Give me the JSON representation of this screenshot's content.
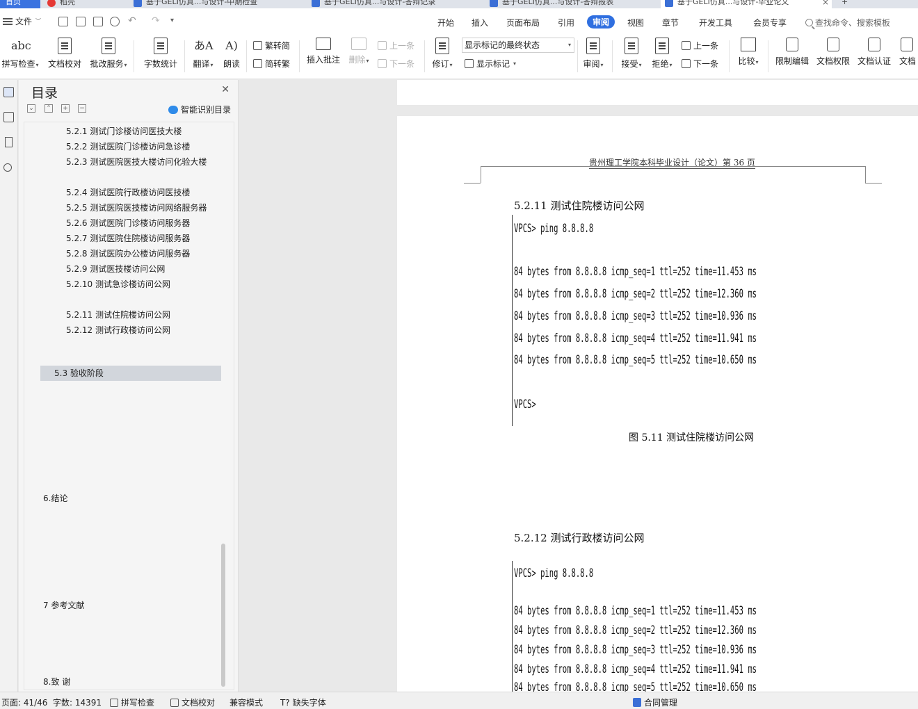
{
  "tabs": [
    {
      "label": "首页",
      "type": "home"
    },
    {
      "label": "稻壳",
      "type": "normal"
    },
    {
      "label": "基于GELI仿真...与设计-中期检查",
      "type": "normal"
    },
    {
      "label": "基于GELI仿真...与设计-答辩记录",
      "type": "normal"
    },
    {
      "label": "基于GELI仿真...与设计-答辩报表",
      "type": "normal"
    },
    {
      "label": "基于GELI仿真...与设计-毕业论文",
      "type": "active"
    }
  ],
  "menubar": {
    "file": "文件",
    "tabs": [
      "开始",
      "插入",
      "页面布局",
      "引用",
      "审阅",
      "视图",
      "章节",
      "开发工具",
      "会员专享"
    ],
    "active_tab": "审阅",
    "search_placeholder": "查找命令、搜索模板"
  },
  "ribbon": {
    "spell_check": "拼写检查",
    "doc_proof": "文档校对",
    "annotate_service": "批改服务",
    "word_count": "字数统计",
    "translate": "翻译",
    "read_aloud": "朗读",
    "trad_to_simp": "繁转简",
    "simp_to_trad": "简转繁",
    "insert_comment": "插入批注",
    "delete": "删除",
    "prev_comment": "上一条",
    "next_comment": "下一条",
    "revise": "修订",
    "markup_mode": "显示标记的最终状态",
    "show_markup": "显示标记",
    "review": "审阅",
    "accept": "接受",
    "reject": "拒绝",
    "prev_change": "上一条",
    "next_change": "下一条",
    "compare": "比较",
    "restrict_edit": "限制编辑",
    "doc_permission": "文档权限",
    "doc_cert": "文档认证",
    "doc_more": "文档"
  },
  "toc": {
    "title": "目录",
    "smart_button": "智能识别目录",
    "items": [
      "5.2.1 测试门诊楼访问医技大楼",
      "5.2.2 测试医院门诊楼访问急诊楼",
      "5.2.3 测试医院医技大楼访问化验大楼",
      "5.2.4 测试医院行政楼访问医技楼",
      "5.2.5 测试医院医技楼访问网络服务器",
      "5.2.6 测试医院门诊楼访问服务器",
      "5.2.7 测试医院住院楼访问服务器",
      "5.2.8 测试医院办公楼访问服务器",
      "5.2.9 测试医技楼访问公网",
      "5.2.10 测试急诊楼访问公网",
      "5.2.11 测试住院楼访问公网",
      "5.2.12 测试行政楼访问公网",
      "5.3 验收阶段",
      "6.结论",
      "7 参考文献",
      "8.致 谢"
    ]
  },
  "document": {
    "header": "贵州理工学院本科毕业设计（论文）第 36 页",
    "section1_heading": "5.2.11 测试住院楼访问公网",
    "section1_terminal": [
      "VPCS> ping 8.8.8.8",
      "84 bytes from 8.8.8.8 icmp_seq=1 ttl=252 time=11.453 ms",
      "84 bytes from 8.8.8.8 icmp_seq=2 ttl=252 time=12.360 ms",
      "84 bytes from 8.8.8.8 icmp_seq=3 ttl=252 time=10.936 ms",
      "84 bytes from 8.8.8.8 icmp_seq=4 ttl=252 time=11.941 ms",
      "84 bytes from 8.8.8.8 icmp_seq=5 ttl=252 time=10.650 ms",
      "VPCS>"
    ],
    "figure_caption": "图 5.11 测试住院楼访问公网",
    "section2_heading": "5.2.12 测试行政楼访问公网",
    "section2_terminal": [
      "VPCS> ping 8.8.8.8",
      "84 bytes from 8.8.8.8 icmp_seq=1 ttl=252 time=11.453 ms",
      "84 bytes from 8.8.8.8 icmp_seq=2 ttl=252 time=12.360 ms",
      "84 bytes from 8.8.8.8 icmp_seq=3 ttl=252 time=10.936 ms",
      "84 bytes from 8.8.8.8 icmp_seq=4 ttl=252 time=11.941 ms",
      "84 bytes from 8.8.8.8 icmp_seq=5 ttl=252 time=10.650 ms"
    ]
  },
  "statusbar": {
    "page": "页面: 41/46",
    "word_count": "字数: 14391",
    "spell_check": "拼写检查",
    "doc_proof": "文档校对",
    "compat_mode": "兼容模式",
    "missing_fonts": "缺失字体",
    "contract_mgmt": "合同管理"
  },
  "colors": {
    "accent": "#2f6fe0",
    "tab_strip": "#dfe3ea",
    "toc_selected": "#d2d6dc"
  }
}
